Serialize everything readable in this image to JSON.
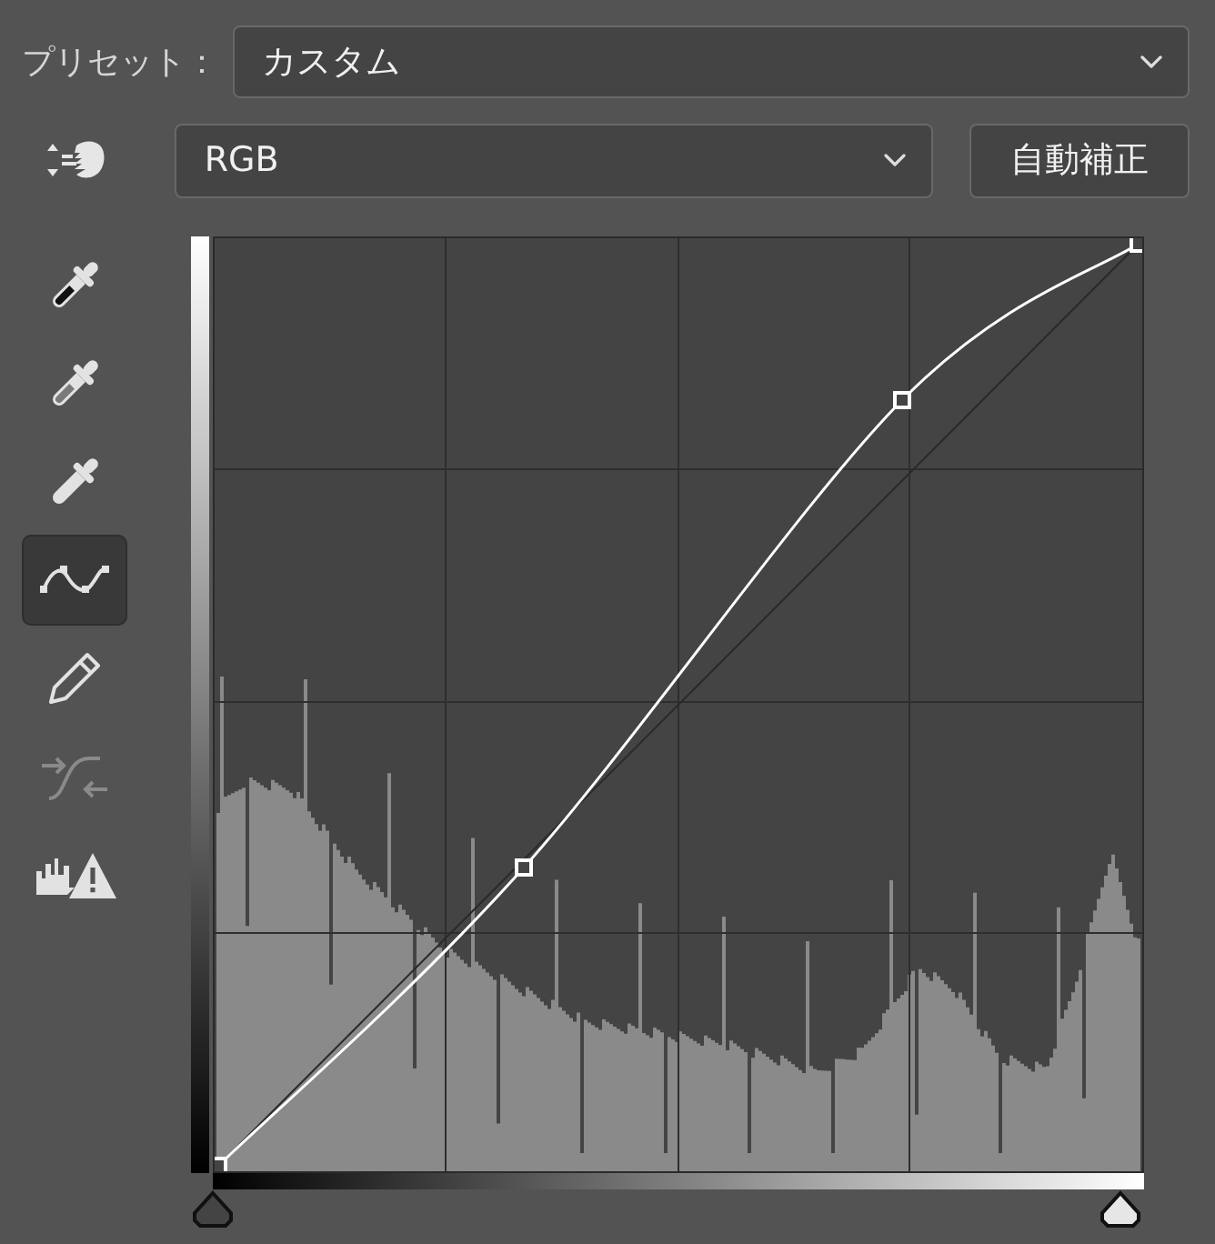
{
  "preset": {
    "label": "プリセット：",
    "value": "カスタム"
  },
  "target_adjust_tool": {
    "selected": false
  },
  "channel": {
    "value": "RGB"
  },
  "auto_button": "自動補正",
  "tools": [
    {
      "kind": "black-eyedropper",
      "selected": false,
      "disabled": false
    },
    {
      "kind": "gray-eyedropper",
      "selected": false,
      "disabled": false
    },
    {
      "kind": "white-eyedropper",
      "selected": false,
      "disabled": false
    },
    {
      "kind": "curve",
      "selected": true,
      "disabled": false
    },
    {
      "kind": "pencil",
      "selected": false,
      "disabled": false
    },
    {
      "kind": "smooth",
      "selected": false,
      "disabled": true
    },
    {
      "kind": "clipping",
      "selected": false,
      "disabled": false
    }
  ]
}
